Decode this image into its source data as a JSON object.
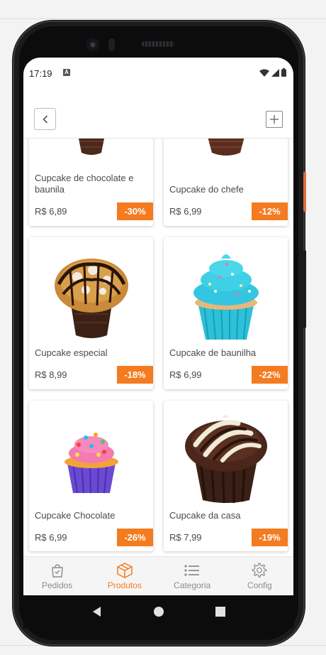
{
  "status_bar": {
    "time": "17:19",
    "notification_glyph": "A"
  },
  "header": {
    "back_icon": "chevron-left-icon",
    "add_icon": "plus-square-icon"
  },
  "products": [
    {
      "name": "Cupcake de chocolate e baunila",
      "price": "R$ 6,89",
      "discount": "-30%"
    },
    {
      "name": "Cupcake do chefe",
      "price": "R$ 6,99",
      "discount": "-12%"
    },
    {
      "name": "Cupcake especial",
      "price": "R$ 8,99",
      "discount": "-18%"
    },
    {
      "name": "Cupcake de baunilha",
      "price": "R$ 6,99",
      "discount": "-22%"
    },
    {
      "name": "Cupcake Chocolate",
      "price": "R$ 6,99",
      "discount": "-26%"
    },
    {
      "name": "Cupcake da casa",
      "price": "R$ 7,99",
      "discount": "-19%"
    }
  ],
  "bottom_nav": [
    {
      "label": "Pedidos",
      "icon": "shopping-bag-check-icon",
      "active": false
    },
    {
      "label": "Produtos",
      "icon": "box-icon",
      "active": true
    },
    {
      "label": "Categoria",
      "icon": "list-icon",
      "active": false
    },
    {
      "label": "Config",
      "icon": "gear-icon",
      "active": false
    }
  ],
  "colors": {
    "accent": "#f47b20",
    "text": "#4a4a4a",
    "nav_inactive": "#8c8c8c"
  }
}
